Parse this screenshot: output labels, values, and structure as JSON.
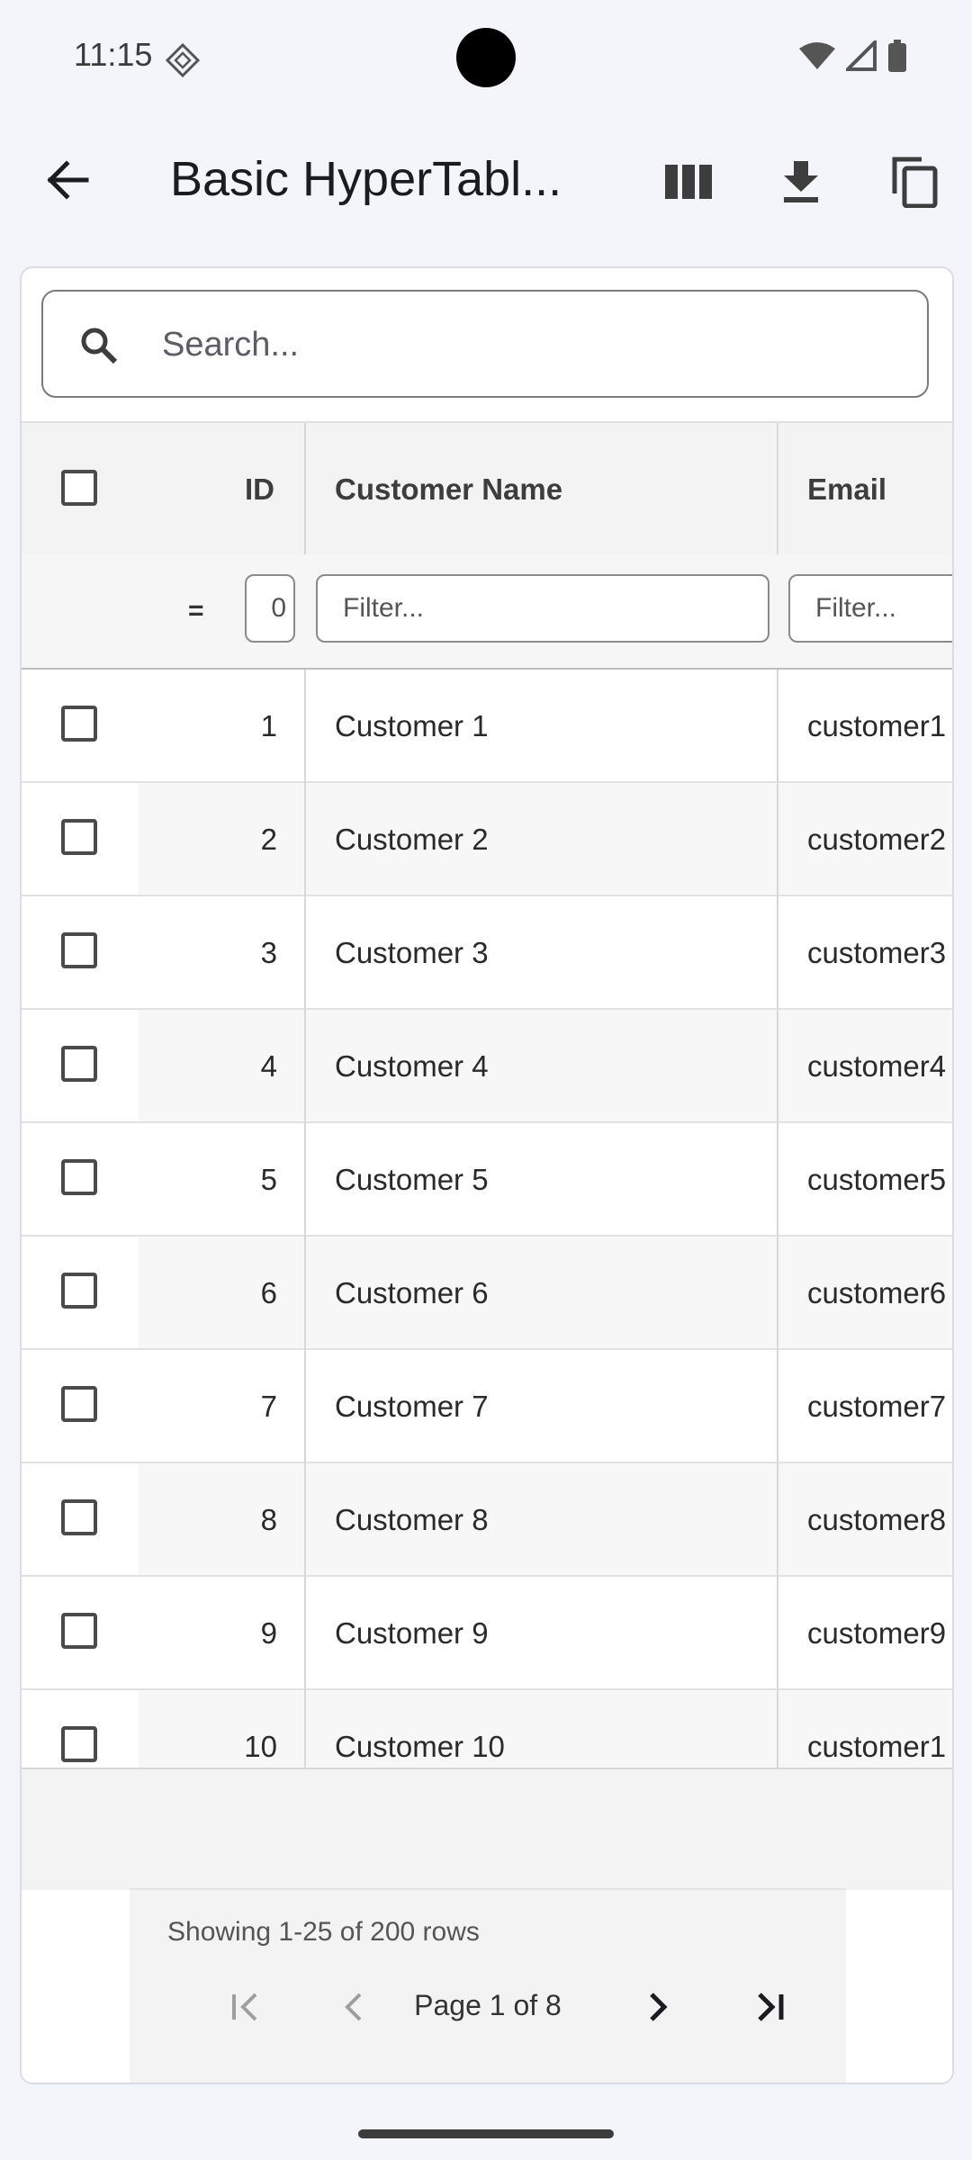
{
  "status": {
    "time": "11:15"
  },
  "appbar": {
    "title": "Basic HyperTabl..."
  },
  "search": {
    "placeholder": "Search..."
  },
  "table": {
    "columns": {
      "id": "ID",
      "name": "Customer Name",
      "email": "Email"
    },
    "filters": {
      "operator": "=",
      "id_value": "0",
      "name_placeholder": "Filter...",
      "email_placeholder": "Filter..."
    },
    "rows": [
      {
        "id": "1",
        "name": "Customer 1",
        "email": "customer1"
      },
      {
        "id": "2",
        "name": "Customer 2",
        "email": "customer2"
      },
      {
        "id": "3",
        "name": "Customer 3",
        "email": "customer3"
      },
      {
        "id": "4",
        "name": "Customer 4",
        "email": "customer4"
      },
      {
        "id": "5",
        "name": "Customer 5",
        "email": "customer5"
      },
      {
        "id": "6",
        "name": "Customer 6",
        "email": "customer6"
      },
      {
        "id": "7",
        "name": "Customer 7",
        "email": "customer7"
      },
      {
        "id": "8",
        "name": "Customer 8",
        "email": "customer8"
      },
      {
        "id": "9",
        "name": "Customer 9",
        "email": "customer9"
      },
      {
        "id": "10",
        "name": "Customer 10",
        "email": "customer1"
      }
    ]
  },
  "pagination": {
    "showing": "Showing 1-25 of 200 rows",
    "page_label": "Page 1 of 8"
  },
  "colors": {
    "stripe": "#f7f7f7",
    "header_bg": "#f3f3f3",
    "icon": "#3d3d3d"
  }
}
